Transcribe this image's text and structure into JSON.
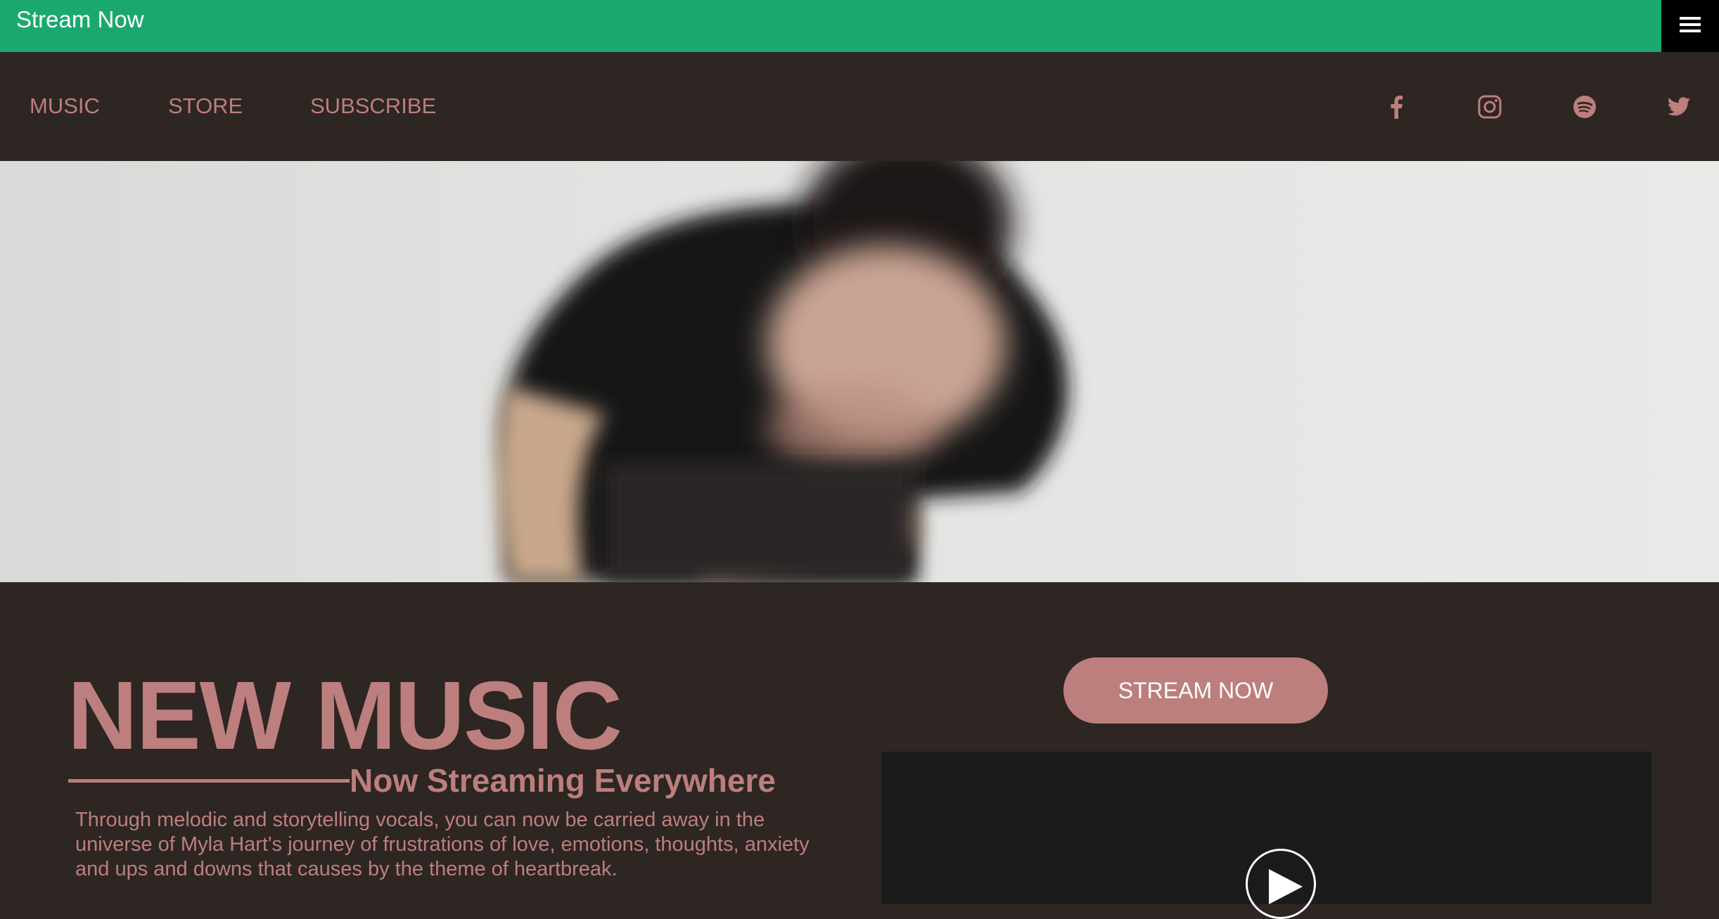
{
  "header": {
    "brand": "Stream Now",
    "menu_icon": "hamburger-icon"
  },
  "nav": {
    "links": [
      "MUSIC",
      "STORE",
      "SUBSCRIBE"
    ],
    "social_icons": [
      "facebook-icon",
      "instagram-icon",
      "spotify-icon",
      "twitter-icon"
    ]
  },
  "hero": {
    "image": "blurred photo of a person in black t-shirt bending forward"
  },
  "main": {
    "headline": "NEW MUSIC",
    "subheadline": "Now Streaming Everywhere",
    "description": "Through melodic and storytelling vocals, you can now be carried away in the universe of Myla Hart's journey of frustrations of love, emotions, thoughts, anxiety and ups and downs that causes by the theme of heartbreak.",
    "cta_label": "STREAM NOW"
  },
  "colors": {
    "topbar": "#1ba86f",
    "background": "#2d2623",
    "accent": "#bd7e7e",
    "video_bg": "#1c1b1b"
  }
}
